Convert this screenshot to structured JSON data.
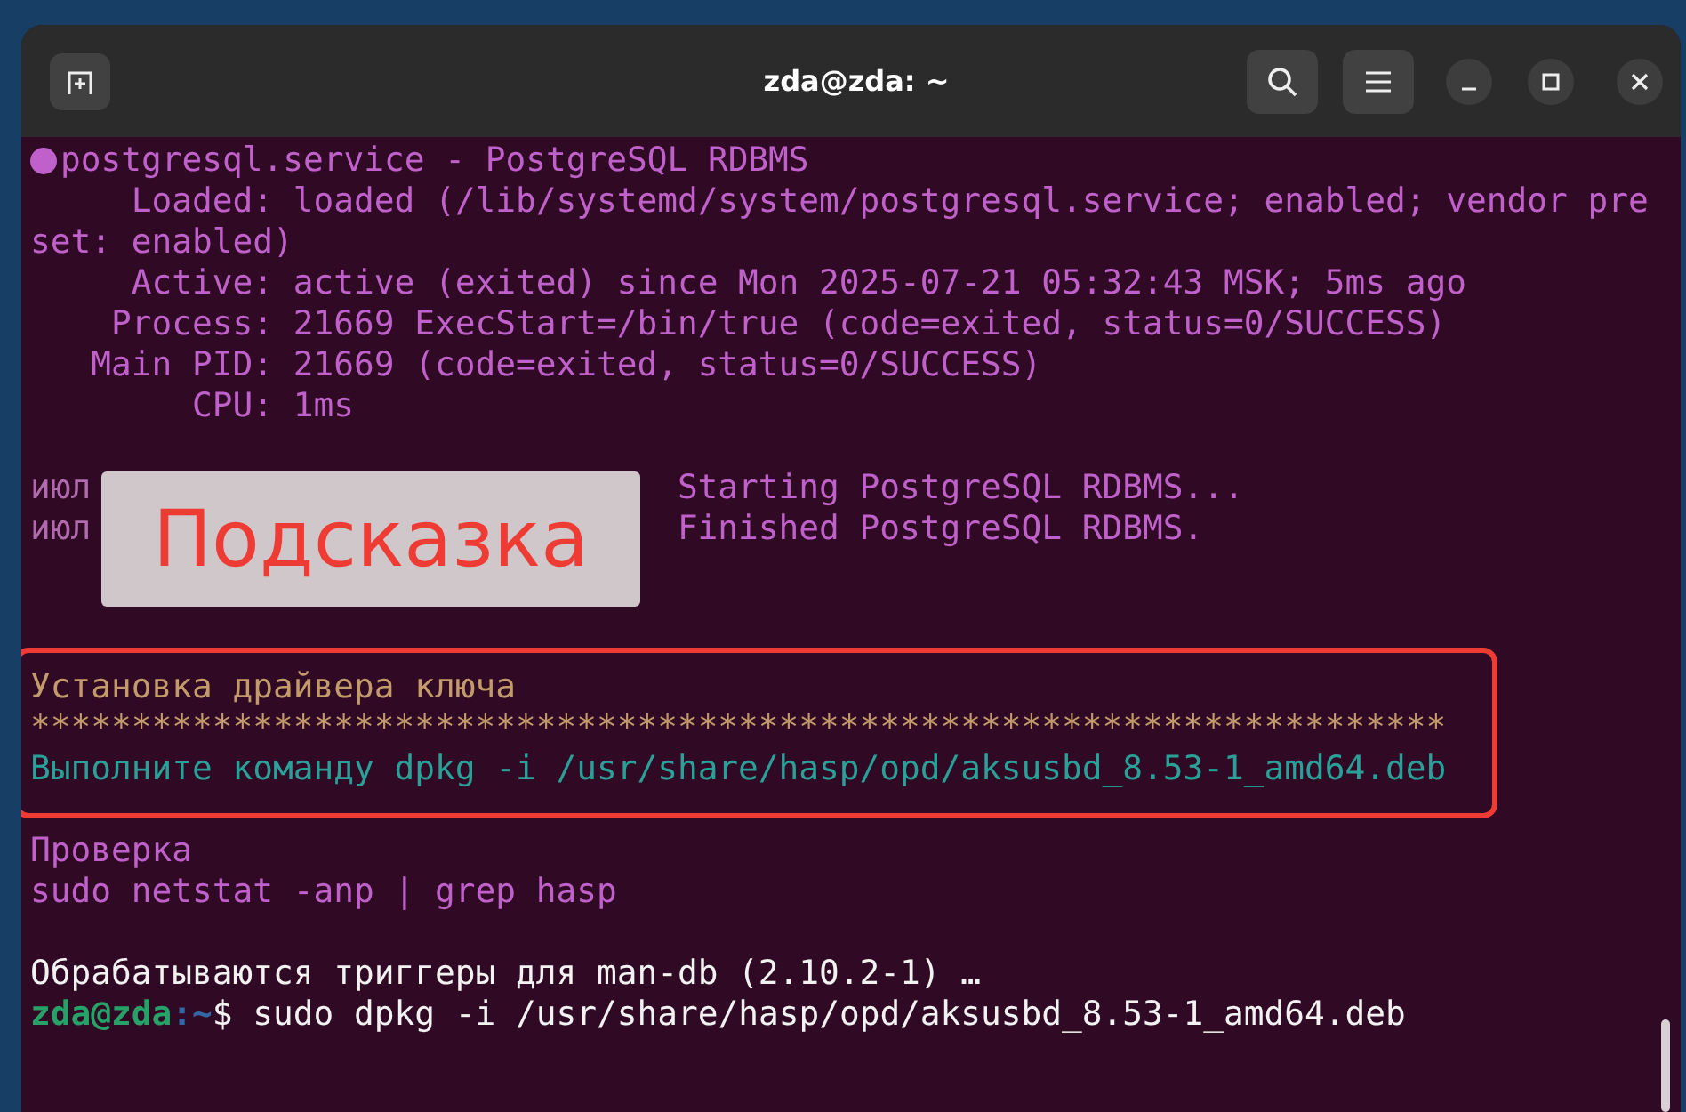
{
  "window": {
    "title": "zda@zda: ~"
  },
  "terminal": {
    "blocks": [
      {
        "kind": "status",
        "lines": [
          {
            "kind": "head",
            "text": "postgresql.service - PostgreSQL RDBMS"
          },
          {
            "kind": "plain",
            "text": "     Loaded: loaded (/lib/systemd/system/postgresql.service; enabled; vendor pre"
          },
          {
            "kind": "plain",
            "text": "set: enabled)"
          },
          {
            "kind": "plain",
            "text": "     Active: active (exited) since Mon 2025-07-21 05:32:43 MSK; 5ms ago"
          },
          {
            "kind": "plain",
            "text": "    Process: 21669 ExecStart=/bin/true (code=exited, status=0/SUCCESS)"
          },
          {
            "kind": "plain",
            "text": "   Main PID: 21669 (code=exited, status=0/SUCCESS)"
          },
          {
            "kind": "plain",
            "text": "        CPU: 1ms"
          }
        ]
      },
      {
        "kind": "journal",
        "lines": [
          {
            "kind": "journal",
            "prefix": "июл",
            "text": "Starting PostgreSQL RDBMS..."
          },
          {
            "kind": "journal",
            "prefix": "июл",
            "text": "Finished PostgreSQL RDBMS."
          }
        ]
      },
      {
        "kind": "hint",
        "lines": [
          {
            "kind": "hint",
            "text": "Установка драйвера ключа"
          },
          {
            "kind": "hint",
            "text": "**********************************************************************"
          },
          {
            "kind": "command",
            "text": "Выполните команду dpkg -i /usr/share/hasp/opd/aksusbd_8.53-1_amd64.deb"
          }
        ]
      },
      {
        "kind": "check",
        "lines": [
          {
            "kind": "plain",
            "text": "Проверка"
          },
          {
            "kind": "plain",
            "text": "sudo netstat -anp | grep hasp"
          }
        ]
      },
      {
        "kind": "output",
        "lines": [
          {
            "kind": "output",
            "text": "Обрабатываются триггеры для man-db (2.10.2-1) …"
          },
          {
            "kind": "prompt",
            "user": "zda@zda",
            "path": ":~",
            "text": "$ sudo dpkg -i /usr/share/hasp/opd/aksusbd_8.53-1_amd64.deb"
          }
        ]
      }
    ]
  },
  "overlay_label": "Подсказка"
}
